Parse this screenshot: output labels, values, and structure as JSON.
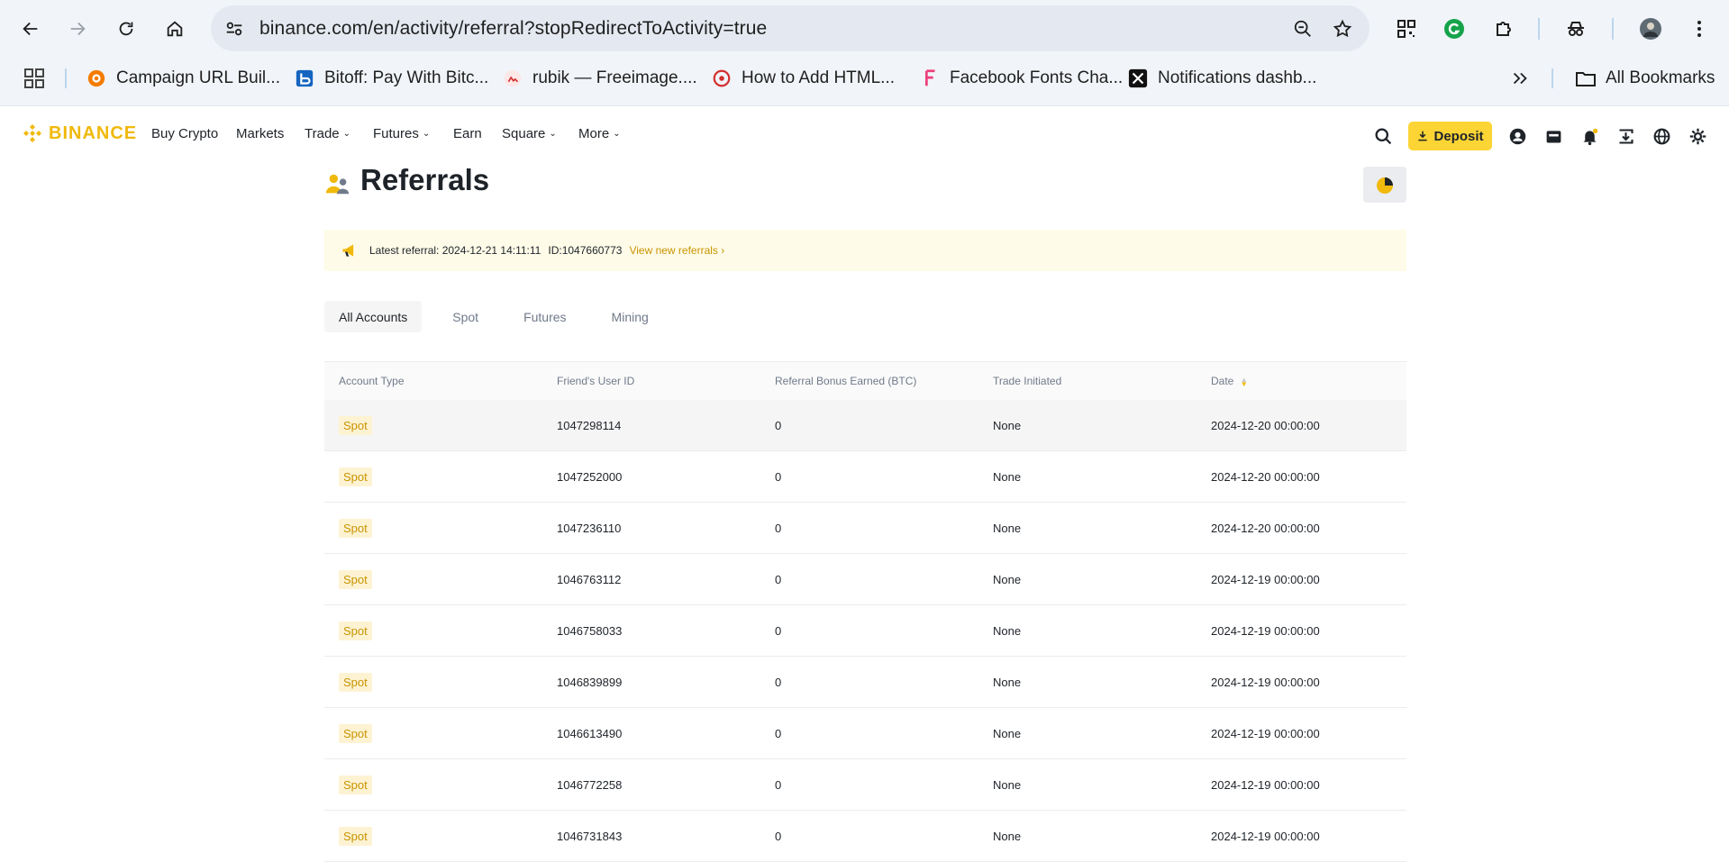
{
  "browser": {
    "url": "binance.com/en/activity/referral?stopRedirectToActivity=true",
    "bookmarks": [
      {
        "label": "Campaign URL Buil..."
      },
      {
        "label": "Bitoff: Pay With Bitc..."
      },
      {
        "label": "rubik — Freeimage...."
      },
      {
        "label": "How to Add HTML..."
      },
      {
        "label": "Facebook Fonts Cha..."
      },
      {
        "label": "Notifications dashb..."
      }
    ],
    "all_bookmarks_label": "All Bookmarks"
  },
  "site": {
    "brand": "BINANCE",
    "nav": [
      {
        "label": "Buy Crypto",
        "dropdown": false
      },
      {
        "label": "Markets",
        "dropdown": false
      },
      {
        "label": "Trade",
        "dropdown": true
      },
      {
        "label": "Futures",
        "dropdown": true
      },
      {
        "label": "Earn",
        "dropdown": false
      },
      {
        "label": "Square",
        "dropdown": true
      },
      {
        "label": "More",
        "dropdown": true
      }
    ],
    "deposit_label": "Deposit",
    "colors": {
      "brand": "#f0b90b",
      "deposit_bg": "#fcd535",
      "link": "#c99400"
    }
  },
  "page": {
    "title": "Referrals",
    "notice": {
      "text": "Latest referral: 2024-12-21 14:11:11",
      "id_text": "ID:1047660773",
      "link": "View new referrals ›"
    },
    "tabs": [
      {
        "label": "All Accounts",
        "active": true
      },
      {
        "label": "Spot",
        "active": false
      },
      {
        "label": "Futures",
        "active": false
      },
      {
        "label": "Mining",
        "active": false
      }
    ],
    "table": {
      "headers": [
        "Account Type",
        "Friend's User ID",
        "Referral Bonus Earned (BTC)",
        "Trade Initiated",
        "Date"
      ],
      "rows": [
        [
          "Spot",
          "1047298114",
          "0",
          "None",
          "2024-12-20 00:00:00"
        ],
        [
          "Spot",
          "1047252000",
          "0",
          "None",
          "2024-12-20 00:00:00"
        ],
        [
          "Spot",
          "1047236110",
          "0",
          "None",
          "2024-12-20 00:00:00"
        ],
        [
          "Spot",
          "1046763112",
          "0",
          "None",
          "2024-12-19 00:00:00"
        ],
        [
          "Spot",
          "1046758033",
          "0",
          "None",
          "2024-12-19 00:00:00"
        ],
        [
          "Spot",
          "1046839899",
          "0",
          "None",
          "2024-12-19 00:00:00"
        ],
        [
          "Spot",
          "1046613490",
          "0",
          "None",
          "2024-12-19 00:00:00"
        ],
        [
          "Spot",
          "1046772258",
          "0",
          "None",
          "2024-12-19 00:00:00"
        ],
        [
          "Spot",
          "1046731843",
          "0",
          "None",
          "2024-12-19 00:00:00"
        ]
      ]
    }
  }
}
